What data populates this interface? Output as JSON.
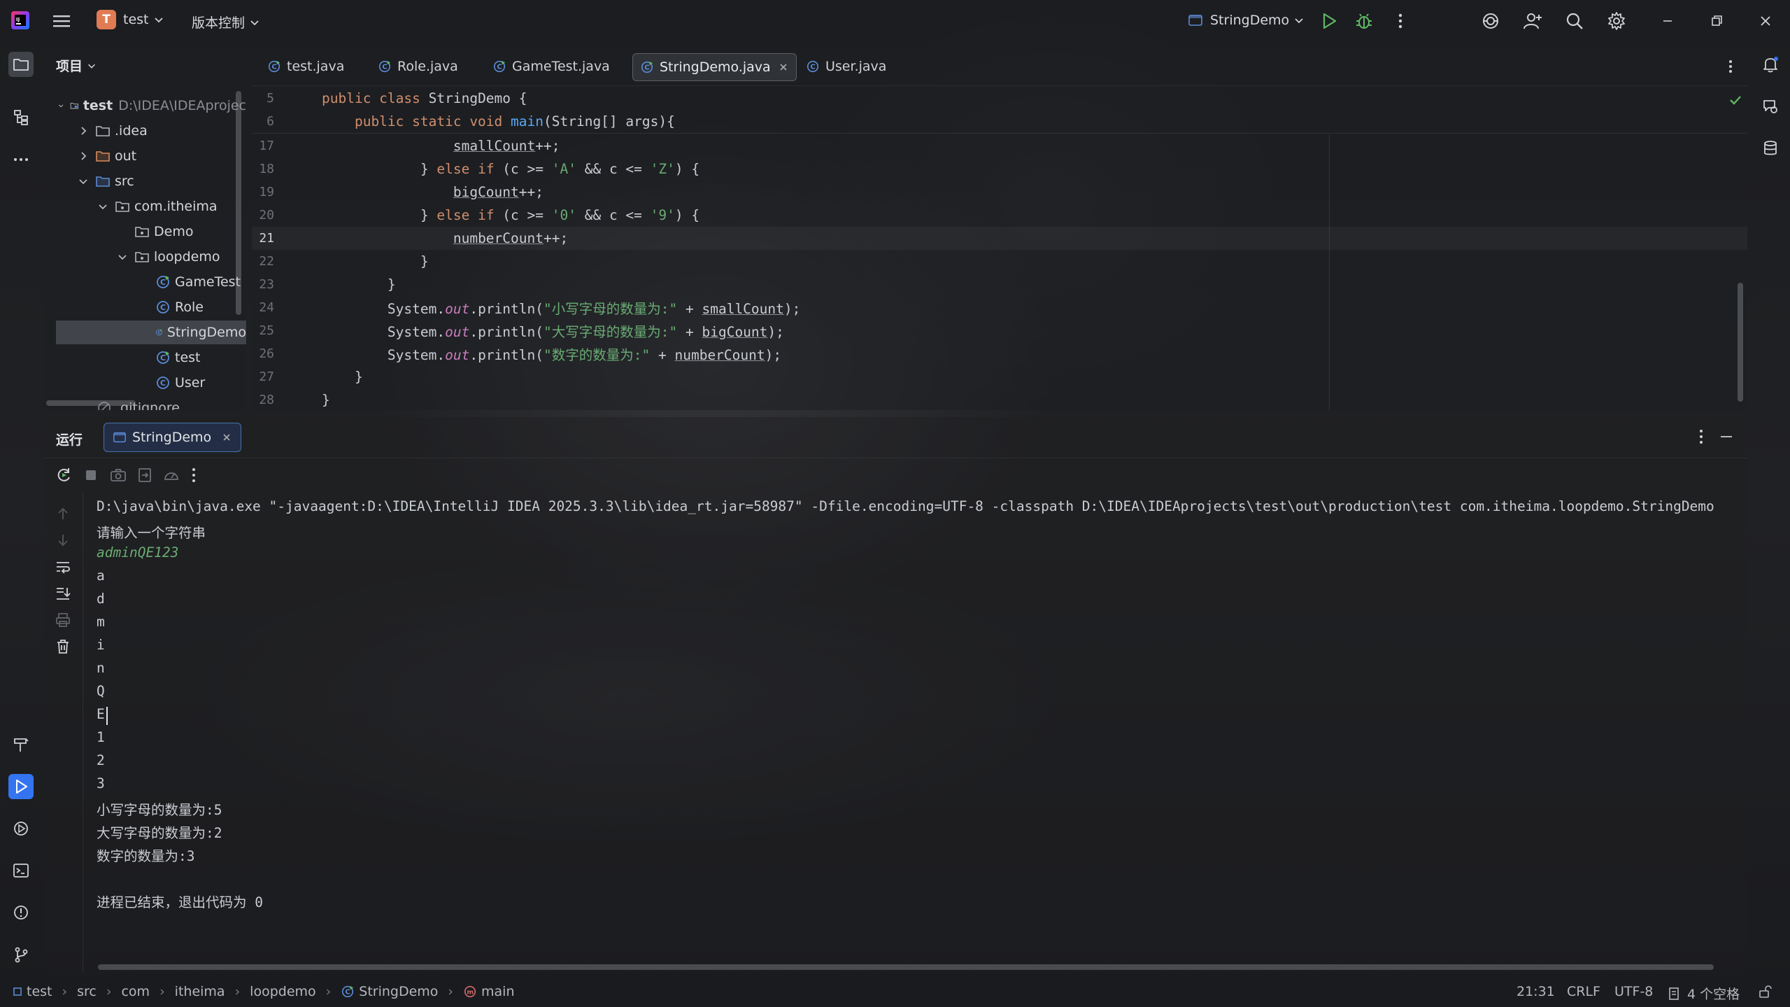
{
  "titlebar": {
    "project_badge": "T",
    "project_name": "test",
    "vcs_label": "版本控制",
    "run_config": "StringDemo"
  },
  "project_panel": {
    "title": "项目",
    "tree": [
      {
        "label": "test",
        "path": "D:\\IDEA\\IDEAprojec"
      },
      {
        "label": ".idea"
      },
      {
        "label": "out"
      },
      {
        "label": "src"
      },
      {
        "label": "com.itheima"
      },
      {
        "label": "Demo"
      },
      {
        "label": "loopdemo"
      },
      {
        "label": "GameTest"
      },
      {
        "label": "Role"
      },
      {
        "label": "StringDemo"
      },
      {
        "label": "test"
      },
      {
        "label": "User"
      },
      {
        "label": ".gitignore"
      }
    ]
  },
  "editor": {
    "tabs": [
      {
        "label": "test.java"
      },
      {
        "label": "Role.java"
      },
      {
        "label": "GameTest.java"
      },
      {
        "label": "StringDemo.java"
      },
      {
        "label": "User.java"
      }
    ],
    "sticky_lines": [
      {
        "num": "5",
        "a": "public class ",
        "b": "StringDemo {"
      },
      {
        "num": "6",
        "a": "    public static void ",
        "b": "main",
        "c": "(String[] args){"
      }
    ],
    "lines": [
      {
        "num": "17",
        "indent": "                ",
        "var": "smallCount",
        "rest": "++;"
      },
      {
        "num": "18",
        "indent": "            ",
        "kw1": "} ",
        "kw2": "else if",
        "c1": " (c >= ",
        "s1": "'A'",
        "c2": " && c <= ",
        "s2": "'Z'",
        "c3": ") {"
      },
      {
        "num": "19",
        "indent": "                ",
        "var": "bigCount",
        "rest": "++;"
      },
      {
        "num": "20",
        "indent": "            ",
        "kw1": "} ",
        "kw2": "else if",
        "c1": " (c >= ",
        "s1": "'0'",
        "c2": " && c <= ",
        "s2": "'9'",
        "c3": ") {"
      },
      {
        "num": "21",
        "indent": "                ",
        "var": "numberCount",
        "rest": "++;"
      },
      {
        "num": "22",
        "text": "            }"
      },
      {
        "num": "23",
        "text": "        }"
      },
      {
        "num": "24",
        "pre": "        System.",
        "out": "out",
        "mid": ".println(",
        "str": "\"小写字母的数量为:\"",
        "plus": " + ",
        "var": "smallCount",
        "end": ");"
      },
      {
        "num": "25",
        "pre": "        System.",
        "out": "out",
        "mid": ".println(",
        "str": "\"大写字母的数量为:\"",
        "plus": " + ",
        "var": "bigCount",
        "end": ");"
      },
      {
        "num": "26",
        "pre": "        System.",
        "out": "out",
        "mid": ".println(",
        "str": "\"数字的数量为:\"",
        "plus": " + ",
        "var": "numberCount",
        "end": ");"
      },
      {
        "num": "27",
        "text": "    }"
      },
      {
        "num": "28",
        "text": "}"
      }
    ]
  },
  "run_panel": {
    "title": "运行",
    "tab_label": "StringDemo",
    "console": [
      "D:\\java\\bin\\java.exe \"-javaagent:D:\\IDEA\\IntelliJ IDEA 2025.3.3\\lib\\idea_rt.jar=58987\" -Dfile.encoding=UTF-8 -classpath D:\\IDEA\\IDEAprojects\\test\\out\\production\\test com.itheima.loopdemo.StringDemo",
      "请输入一个字符串",
      "adminQE123",
      "a",
      "d",
      "m",
      "i",
      "n",
      "Q",
      "E",
      "1",
      "2",
      "3",
      "小写字母的数量为:5",
      "大写字母的数量为:2",
      "数字的数量为:3",
      "",
      "进程已结束，退出代码为 0"
    ]
  },
  "statusbar": {
    "breadcrumbs": [
      "test",
      "src",
      "com",
      "itheima",
      "loopdemo",
      "StringDemo",
      "main"
    ],
    "position": "21:31",
    "line_sep": "CRLF",
    "encoding": "UTF-8",
    "indent": "4 个空格"
  },
  "colors": {
    "accent": "#3574f0",
    "run_green": "#5fb865",
    "keyword": "#cf8e6d",
    "string": "#6aab73",
    "function": "#56a8f5",
    "field": "#c77dbb"
  }
}
